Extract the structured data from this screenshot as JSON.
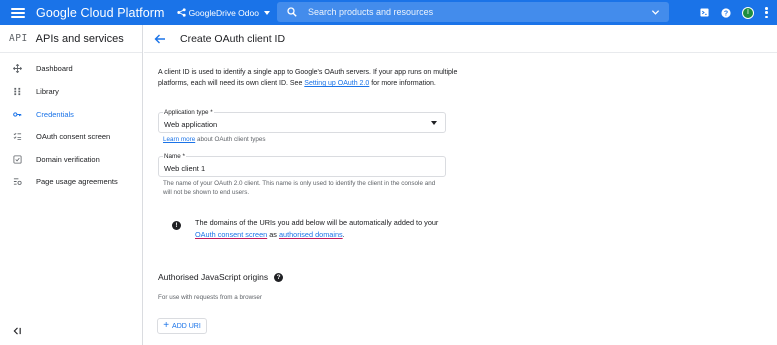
{
  "topbar": {
    "brand": "Google Cloud Platform",
    "project": "GoogleDrive Odoo",
    "search_placeholder": "Search products and resources",
    "avatar_initial": "I"
  },
  "sidebar": {
    "api_label": "API",
    "title": "APIs and services",
    "items": [
      {
        "label": "Dashboard",
        "icon": "dashboard-icon",
        "active": false
      },
      {
        "label": "Library",
        "icon": "library-icon",
        "active": false
      },
      {
        "label": "Credentials",
        "icon": "key-icon",
        "active": true
      },
      {
        "label": "OAuth consent screen",
        "icon": "consent-icon",
        "active": false
      },
      {
        "label": "Domain verification",
        "icon": "checkbox-icon",
        "active": false
      },
      {
        "label": "Page usage agreements",
        "icon": "settings-list-icon",
        "active": false
      }
    ]
  },
  "main": {
    "title": "Create OAuth client ID",
    "intro_text": "A client ID is used to identify a single app to Google's OAuth servers. If your app runs on multiple platforms, each will need its own client ID. See ",
    "intro_link": "Setting up OAuth 2.0",
    "intro_tail": " for more information.",
    "app_type": {
      "label": "Application type *",
      "value": "Web application",
      "hint_link": "Learn more",
      "hint_text": " about OAuth client types"
    },
    "name": {
      "label": "Name *",
      "value": "Web client 1",
      "hint": "The name of your OAuth 2.0 client. This name is only used to identify the client in the console and will not be shown to end users."
    },
    "info": {
      "text1": "The domains of the URIs you add below will be automatically added to your ",
      "link1": "OAuth consent screen",
      "text2": " as ",
      "link2": "authorised domains",
      "text3": "."
    },
    "js_origins": {
      "title": "Authorised JavaScript origins",
      "hint": "For use with requests from a browser",
      "add_label": "ADD URI"
    }
  },
  "colors": {
    "accent": "#1a73e8",
    "topbar": "#1a73e8",
    "avatar": "#1e8e3e"
  }
}
